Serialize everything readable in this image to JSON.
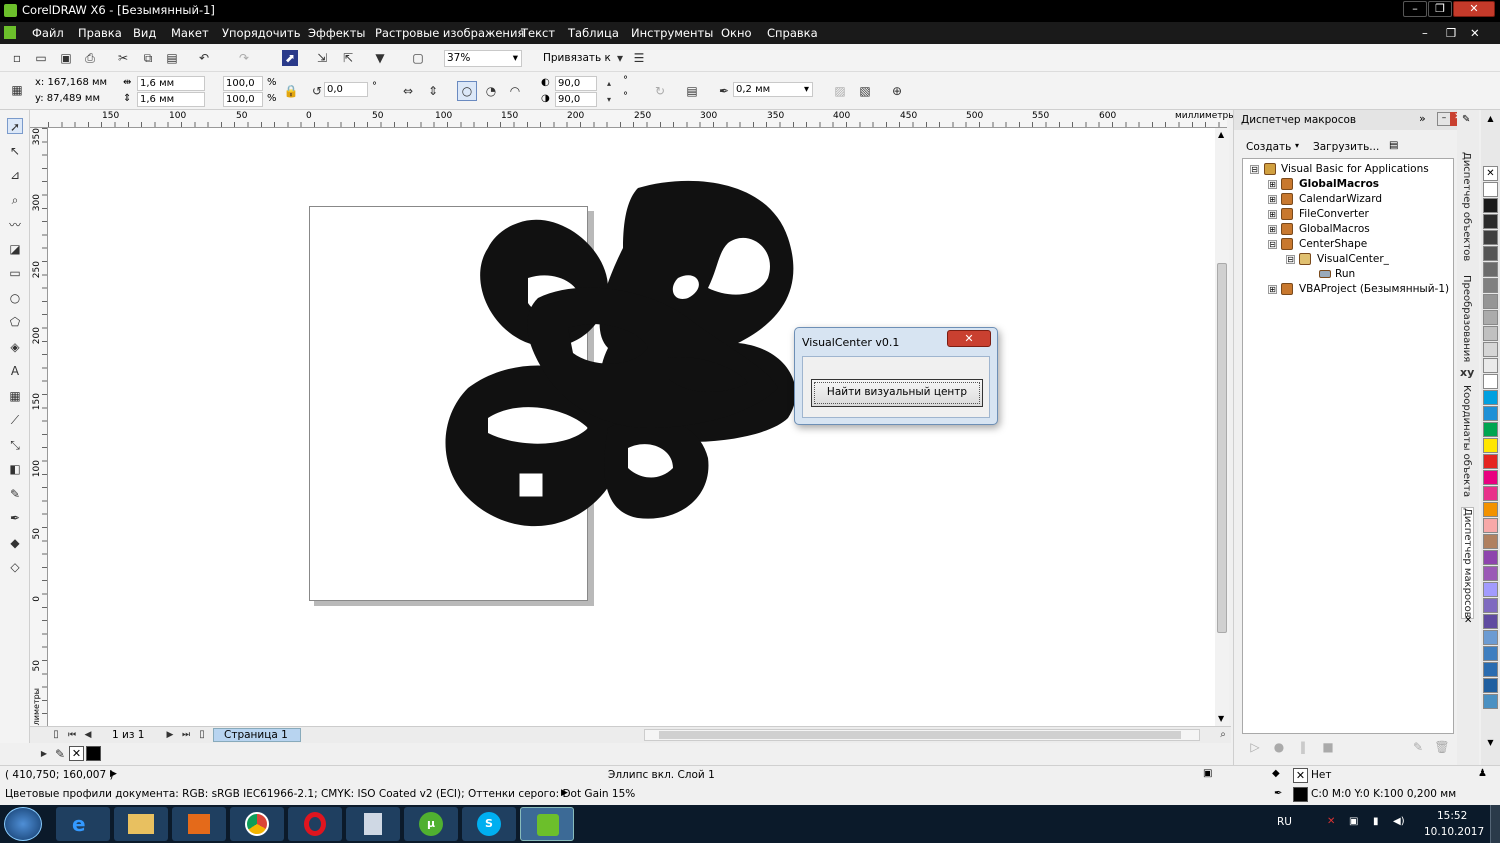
{
  "window": {
    "title": "CorelDRAW X6 - [Безымянный-1]"
  },
  "menu": [
    "Файл",
    "Правка",
    "Вид",
    "Макет",
    "Упорядочить",
    "Эффекты",
    "Растровые изображения",
    "Текст",
    "Таблица",
    "Инструменты",
    "Окно",
    "Справка"
  ],
  "stdbar": {
    "zoom": "37%",
    "snap": "Привязать к"
  },
  "propbar": {
    "x": "x: 167,168 мм",
    "y": "y: 87,489 мм",
    "w": "1,6 мм",
    "h": "1,6 мм",
    "sx": "100,0",
    "sy": "100,0",
    "pct": "%",
    "rot": "0,0",
    "deg": "°",
    "a1": "90,0",
    "a2": "90,0",
    "outline": "0,2 мм"
  },
  "ruler": {
    "unit": "миллиметры",
    "h_ticks": [
      "150",
      "100",
      "50",
      "0",
      "50",
      "100",
      "150",
      "200",
      "250",
      "300",
      "350",
      "400",
      "450",
      "500",
      "550",
      "600"
    ],
    "v_ticks": [
      "350",
      "300",
      "250",
      "200",
      "150",
      "100",
      "50",
      "0",
      "50"
    ]
  },
  "pagebar": {
    "counter": "1 из 1",
    "page_tab": "Страница 1"
  },
  "dialog": {
    "title": "VisualCenter v0.1",
    "close": "✕",
    "button": "Найти визуальный центр"
  },
  "docker": {
    "title": "Диспетчер макросов",
    "create": "Создать",
    "load": "Загрузить...",
    "tree": [
      {
        "label": "Visual Basic for Applications",
        "level": 0,
        "box": "⊟",
        "bold": false
      },
      {
        "label": "GlobalMacros",
        "level": 1,
        "box": "⊞",
        "bold": true
      },
      {
        "label": "CalendarWizard",
        "level": 1,
        "box": "⊞",
        "bold": false
      },
      {
        "label": "FileConverter",
        "level": 1,
        "box": "⊞",
        "bold": false
      },
      {
        "label": "GlobalMacros",
        "level": 1,
        "box": "⊞",
        "bold": false
      },
      {
        "label": "CenterShape",
        "level": 1,
        "box": "⊟",
        "bold": false
      },
      {
        "label": "VisualCenter_",
        "level": 2,
        "box": "⊟",
        "bold": false
      },
      {
        "label": "Run",
        "level": 3,
        "box": "",
        "bold": false
      },
      {
        "label": "VBAProject (Безымянный-1)",
        "level": 1,
        "box": "⊞",
        "bold": false
      }
    ]
  },
  "side_tabs": [
    "Диспетчер объектов",
    "Преобразования",
    "Координаты объекта",
    "Диспетчер макросов"
  ],
  "side_xy": "xy",
  "status": {
    "coords": "( 410,750; 160,007 )",
    "object": "Эллипс вкл. Слой 1",
    "fill": "Нет",
    "stroke": "C:0 M:0 Y:0 K:100  0,200 мм",
    "profiles": "Цветовые профили документа: RGB: sRGB IEC61966-2.1; CMYK: ISO Coated v2 (ECI); Оттенки серого: Dot Gain 15%"
  },
  "taskbar": {
    "lang": "RU",
    "time": "15:52",
    "date": "10.10.2017"
  },
  "palette": [
    "#ffffff",
    "#1a1a1a",
    "#2b2b2b",
    "#3f3f3f",
    "#555555",
    "#6b6b6b",
    "#808080",
    "#969696",
    "#ababab",
    "#c0c0c0",
    "#d6d6d6",
    "#eaeaea",
    "#ffffff",
    "#00a0e0",
    "#1e90d6",
    "#00a550",
    "#ffe600",
    "#e52420",
    "#e8007f",
    "#e8308a",
    "#f39200",
    "#f7a8a8",
    "#b08060",
    "#8e44ad",
    "#9b59b6",
    "#a29bfe",
    "#7f6ac0",
    "#5f4aa0",
    "#6c9bd2",
    "#3f7fc0",
    "#2a6cb0",
    "#1f5fa0",
    "#4a90c2"
  ]
}
